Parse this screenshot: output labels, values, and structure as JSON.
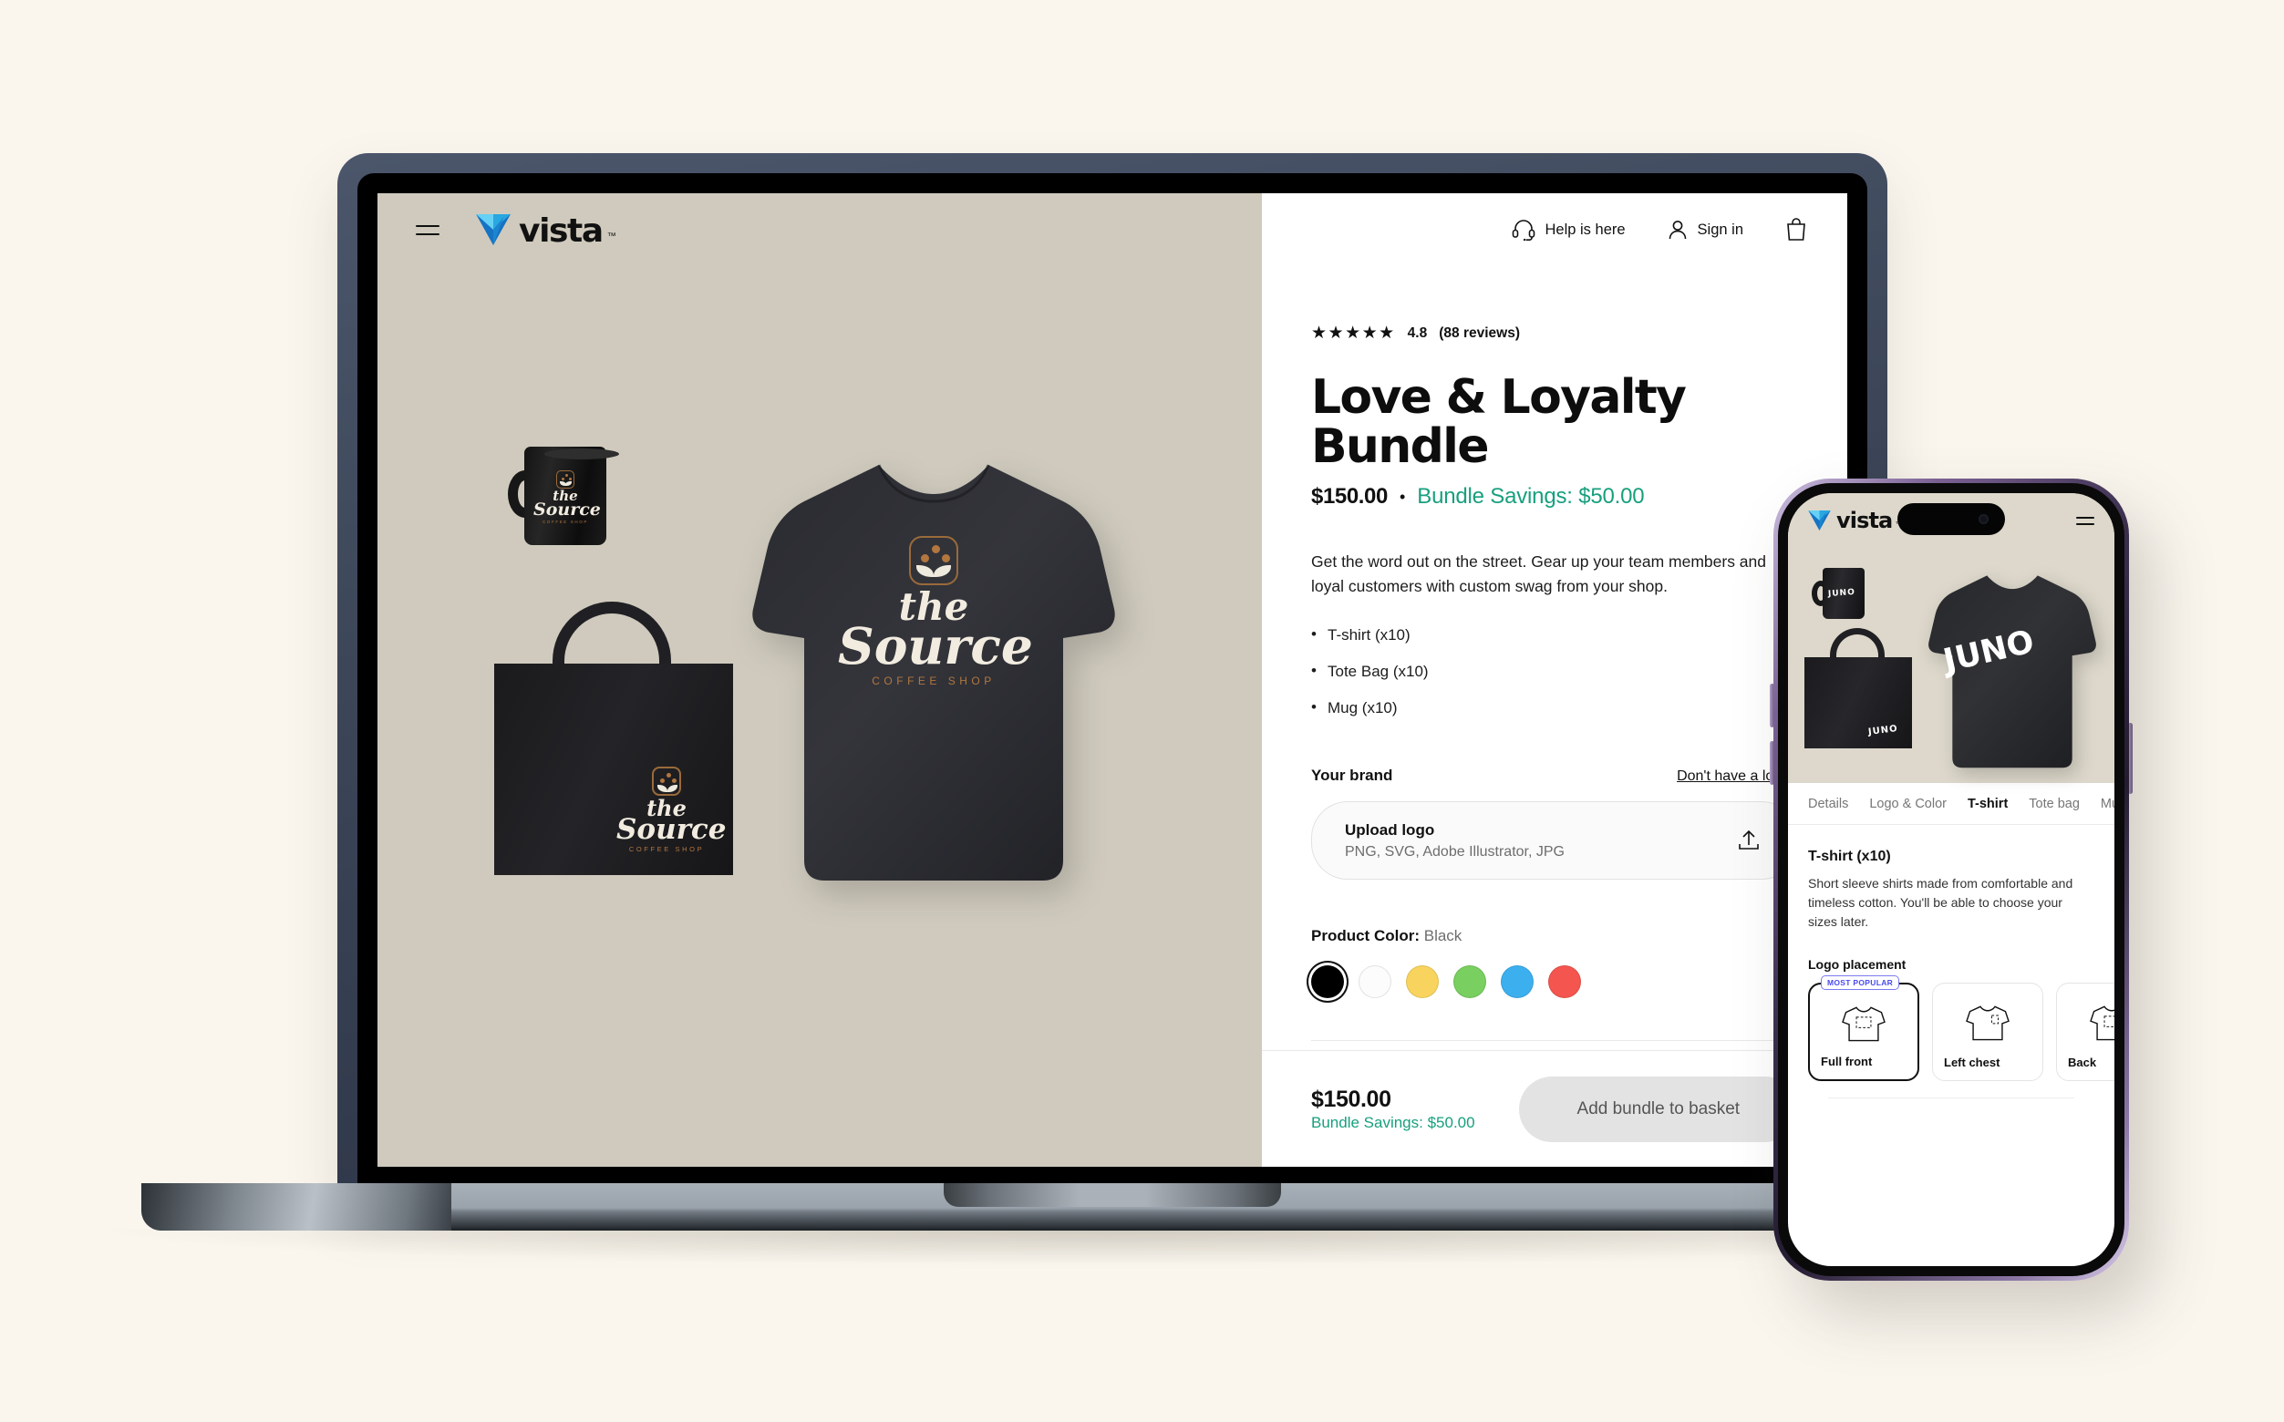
{
  "brand": {
    "name": "vista",
    "tm": "™"
  },
  "laptop": {
    "header": {
      "menu_icon": "hamburger-icon",
      "help_label": "Help is here",
      "signin_label": "Sign in",
      "cart_icon": "basket-icon"
    },
    "gallery": {
      "logo_script_line1": "the",
      "logo_script_line2": "Source",
      "logo_sub": "COFFEE SHOP",
      "background_color": "#cfcabd"
    },
    "detail": {
      "stars": "★★★★★",
      "rating_value": "4.8",
      "review_count": "(88 reviews)",
      "title": "Love & Loyalty Bundle",
      "price": "$150.00",
      "separator": "•",
      "savings": "Bundle Savings: $50.00",
      "description": "Get the word out on the street. Gear up your team members and loyal customers with custom swag from your shop.",
      "items": [
        "T-shirt (x10)",
        "Tote Bag (x10)",
        "Mug (x10)"
      ],
      "brand_label": "Your brand",
      "brand_link": "Don't have a logo?",
      "upload_title": "Upload logo",
      "upload_formats": "PNG, SVG, Adobe Illustrator, JPG",
      "upload_icon": "upload-icon",
      "color_label": "Product Color:",
      "color_value": "Black",
      "swatches": [
        {
          "name": "Black",
          "hex": "#000000",
          "selected": true
        },
        {
          "name": "White",
          "hex": "#fcfcfc",
          "selected": false
        },
        {
          "name": "Yellow",
          "hex": "#f8d45e",
          "selected": false
        },
        {
          "name": "Green",
          "hex": "#79cf5f",
          "selected": false
        },
        {
          "name": "Blue",
          "hex": "#3cafef",
          "selected": false
        },
        {
          "name": "Red",
          "hex": "#f4554f",
          "selected": false
        }
      ]
    },
    "buybar": {
      "price": "$150.00",
      "savings": "Bundle Savings: $50.00",
      "cta": "Add bundle to basket"
    }
  },
  "phone": {
    "header": {
      "menu_icon": "hamburger-icon"
    },
    "gallery": {
      "logo_text": "JUNO",
      "background_color": "#ddd8cb"
    },
    "tabs": [
      {
        "label": "Details",
        "active": false
      },
      {
        "label": "Logo & Color",
        "active": false
      },
      {
        "label": "T-shirt",
        "active": true
      },
      {
        "label": "Tote bag",
        "active": false
      },
      {
        "label": "Mug",
        "active": false
      }
    ],
    "content": {
      "title": "T-shirt (x10)",
      "description": "Short sleeve shirts made from comfortable and timeless cotton. You'll be able to choose your sizes later.",
      "placement_label": "Logo placement",
      "placements": [
        {
          "name": "Full front",
          "badge": "MOST POPULAR",
          "selected": true
        },
        {
          "name": "Left chest",
          "badge": "",
          "selected": false
        },
        {
          "name": "Back",
          "badge": "",
          "selected": false
        }
      ]
    }
  },
  "theme": {
    "page_bg": "#faf6ee",
    "accent_green": "#17a07e",
    "accent_blue": "#4a4aee",
    "vista_blue_light": "#67d0f5",
    "vista_blue_mid": "#2aa7e0",
    "vista_blue_dark": "#1573c4"
  }
}
